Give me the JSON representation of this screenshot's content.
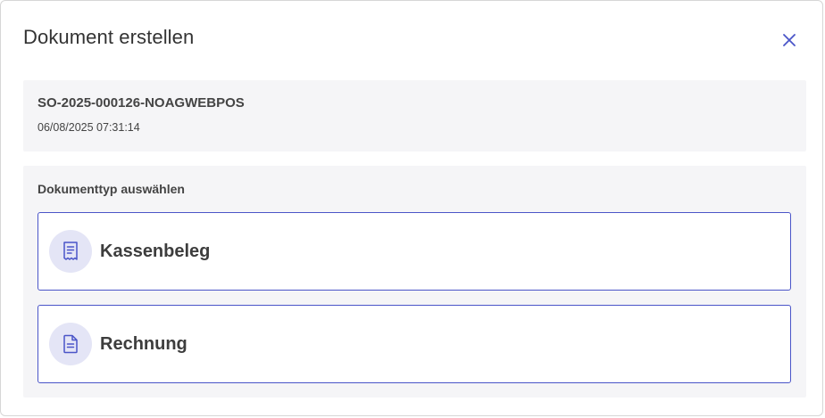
{
  "dialog": {
    "title": "Dokument erstellen",
    "close_icon": "close-icon"
  },
  "document": {
    "number": "SO-2025-000126-NOAGWEBPOS",
    "datetime": "06/08/2025 07:31:14"
  },
  "selection": {
    "label": "Dokumenttyp auswählen",
    "options": [
      {
        "label": "Kassenbeleg",
        "icon": "receipt-icon"
      },
      {
        "label": "Rechnung",
        "icon": "invoice-document-icon"
      }
    ]
  },
  "colors": {
    "accent": "#4a55c8",
    "icon_bg": "#e4e5f6",
    "panel_bg": "#f5f5f7"
  }
}
